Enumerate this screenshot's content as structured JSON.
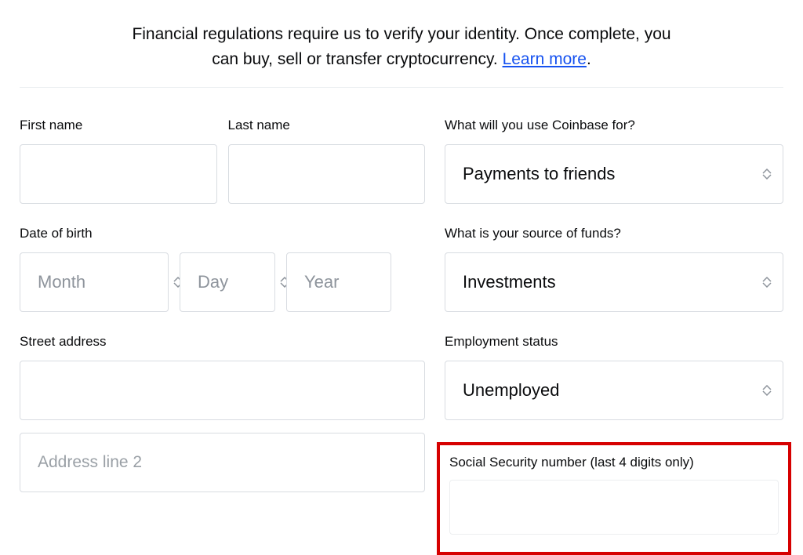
{
  "intro": {
    "text_line1": "Financial regulations require us to verify your identity. Once complete, you",
    "text_line2": "can buy, sell or transfer cryptocurrency. ",
    "learn_more": "Learn more",
    "period": "."
  },
  "left": {
    "first_name_label": "First name",
    "last_name_label": "Last name",
    "dob_label": "Date of birth",
    "dob_month": "Month",
    "dob_day": "Day",
    "dob_year": "Year",
    "street_label": "Street address",
    "address2_placeholder": "Address line 2"
  },
  "right": {
    "use_label": "What will you use Coinbase for?",
    "use_value": "Payments to friends",
    "funds_label": "What is your source of funds?",
    "funds_value": "Investments",
    "employment_label": "Employment status",
    "employment_value": "Unemployed",
    "ssn_label": "Social Security number (last 4 digits only)"
  }
}
